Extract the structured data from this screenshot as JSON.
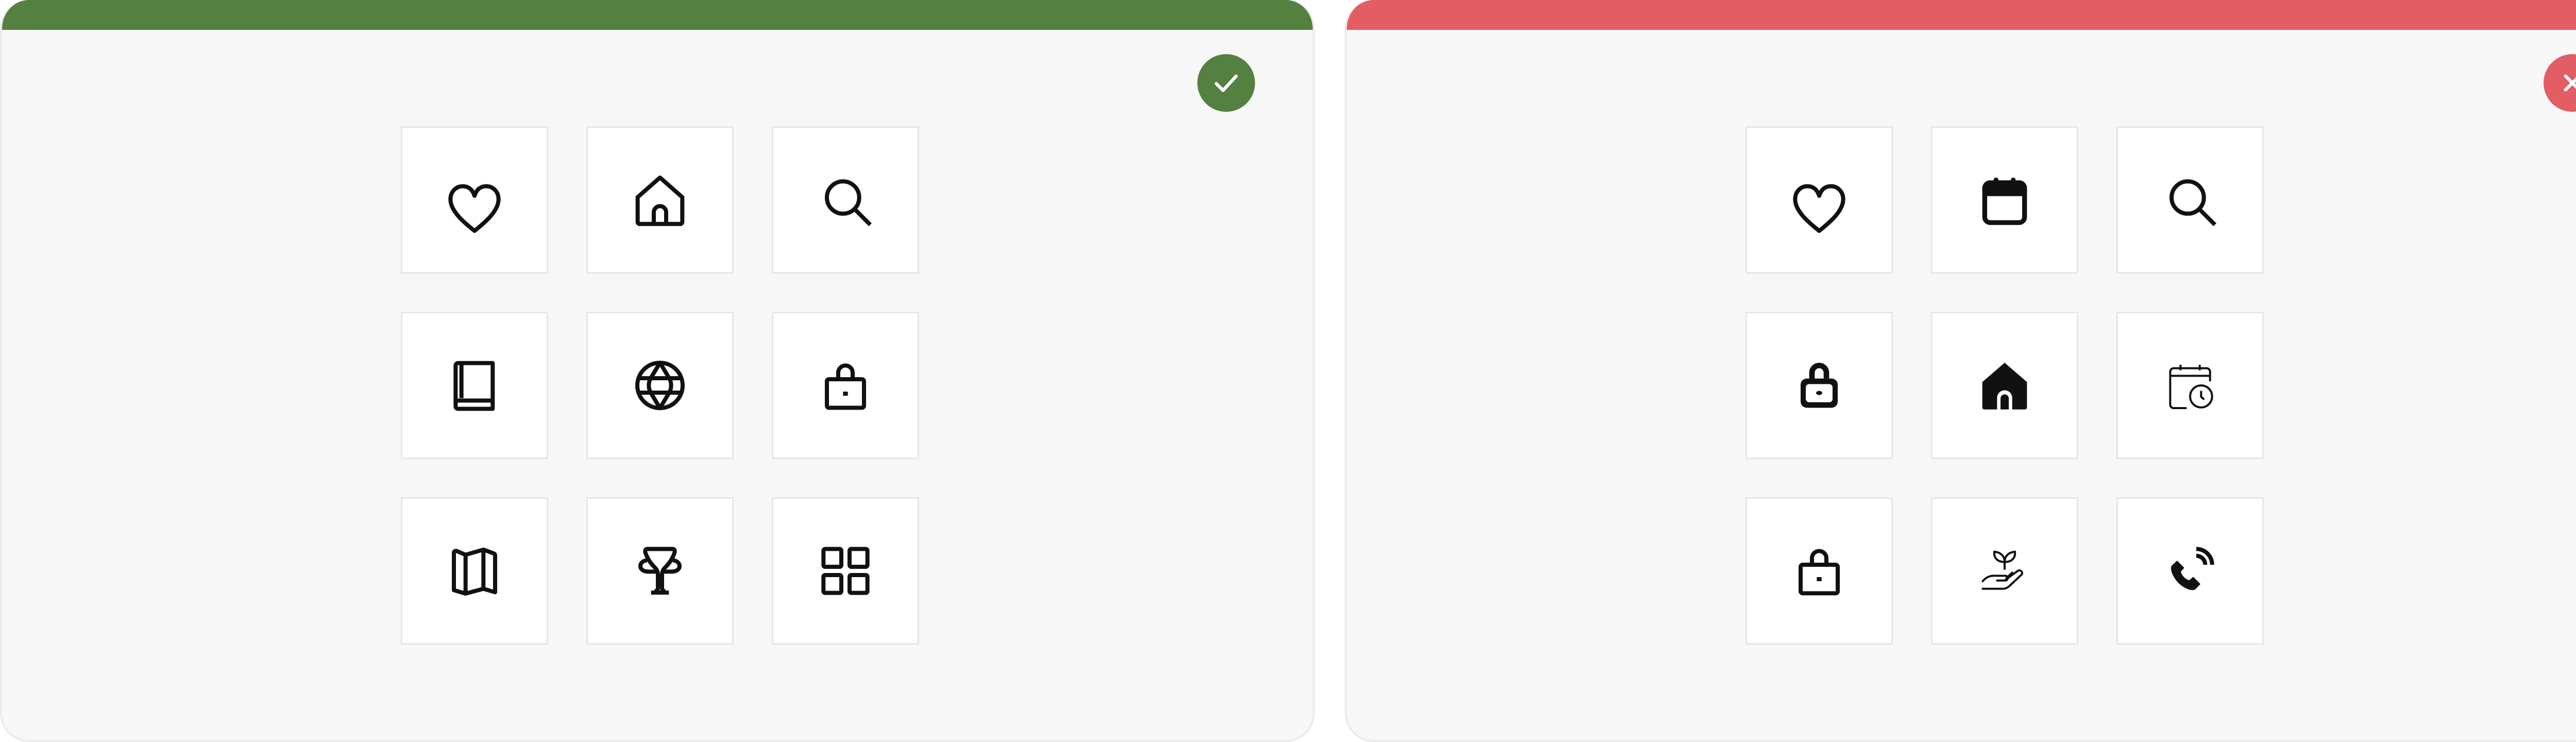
{
  "colors": {
    "good": "#548040",
    "bad": "#e35d64",
    "panel_bg": "#f7f7f7",
    "tile_bg": "#ffffff",
    "tile_border": "#e6e6e6",
    "icon": "#111111"
  },
  "good_example": {
    "status_icon": "checkmark-icon",
    "icons": [
      "heart-icon",
      "home-icon",
      "search-icon",
      "book-icon",
      "globe-icon",
      "lock-icon",
      "map-icon",
      "trophy-icon",
      "grid-icon"
    ]
  },
  "bad_example": {
    "status_icon": "close-icon",
    "icons": [
      "heart-icon",
      "calendar-filled-icon",
      "search-icon",
      "lock-filled-icon",
      "home-filled-icon",
      "calendar-clock-thin-icon",
      "lock-icon",
      "plant-hand-thin-icon",
      "phone-signal-filled-icon"
    ]
  }
}
